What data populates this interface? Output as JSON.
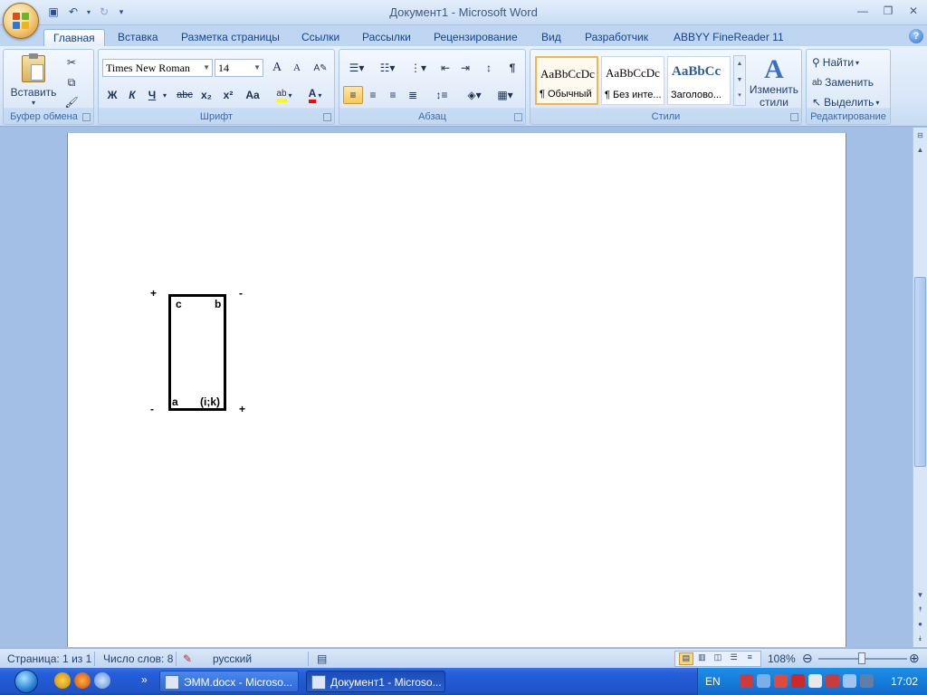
{
  "window": {
    "title": "Документ1 - Microsoft Word"
  },
  "tabs": [
    "Главная",
    "Вставка",
    "Разметка страницы",
    "Ссылки",
    "Рассылки",
    "Рецензирование",
    "Вид",
    "Разработчик",
    "ABBYY FineReader 11"
  ],
  "ribbon": {
    "clipboard": {
      "label": "Буфер обмена",
      "paste": "Вставить"
    },
    "font": {
      "label": "Шрифт",
      "family": "Times New Roman",
      "size": "14",
      "bold": "Ж",
      "italic": "К",
      "underline": "Ч",
      "strike": "abc",
      "sub": "x₂",
      "sup": "x²",
      "case": "Aa",
      "grow": "A",
      "shrink": "A"
    },
    "paragraph": {
      "label": "Абзац",
      "pilcrow": "¶"
    },
    "styles": {
      "label": "Стили",
      "items": [
        {
          "sample": "AaBbCcDc",
          "name": "¶ Обычный"
        },
        {
          "sample": "AaBbCcDc",
          "name": "¶ Без инте..."
        },
        {
          "sample": "AaBbCc",
          "name": "Заголово..."
        }
      ],
      "change_label_1": "Изменить",
      "change_label_2": "стили"
    },
    "editing": {
      "label": "Редактирование",
      "find": "Найти",
      "replace": "Заменить",
      "select": "Выделить"
    }
  },
  "document": {
    "labels": {
      "plus_top": "+",
      "minus_top": "-",
      "minus_bottom": "-",
      "plus_bottom": "+",
      "c": "c",
      "b": "b",
      "a": "a",
      "ik": "(i;k)"
    }
  },
  "statusbar": {
    "page": "Страница: 1 из 1",
    "words": "Число слов: 8",
    "lang": "русский",
    "zoom": "108%"
  },
  "taskbar": {
    "tasks": [
      {
        "label": "ЭММ.docx - Microso..."
      },
      {
        "label": "Документ1 - Microso..."
      }
    ],
    "lang": "EN",
    "time": "17:02"
  },
  "colors": {
    "highlight": "#ffff00",
    "font_color": "#ff0000",
    "accent": "#15428b"
  }
}
